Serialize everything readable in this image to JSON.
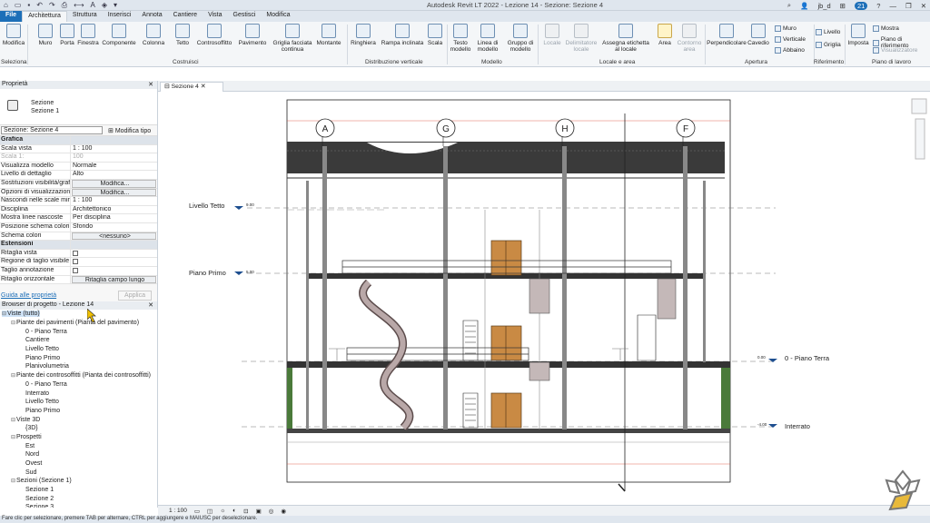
{
  "titlebar": {
    "title": "Autodesk Revit LT 2022 - Lezione 14 - Sezione: Sezione 4",
    "user": "jb_d",
    "badge": "21"
  },
  "tabs": [
    "File",
    "Architettura",
    "Struttura",
    "Inserisci",
    "Annota",
    "Cantiere",
    "Vista",
    "Gestisci",
    "Modifica"
  ],
  "ribbon": {
    "buttons": [
      "Modifica",
      "Muro",
      "Porta",
      "Finestra",
      "Componente",
      "Colonna",
      "Tetto",
      "Controsoffitto",
      "Pavimento",
      "Griglia facciata continua",
      "Montante",
      "Ringhiera",
      "Rampa inclinata",
      "Scala",
      "Testo modello",
      "Linea di modello",
      "Gruppo di modello",
      "Locale",
      "Delimitatore locale",
      "Assegna etichetta al locale",
      "Area",
      "Contorno area",
      "Perpendicolare",
      "Cavedio",
      "Imposta"
    ],
    "small": [
      "Muro",
      "Verticale",
      "Abbaino",
      "Livello",
      "Griglia",
      "Mostra",
      "Piano di riferimento",
      "Visualizzatore"
    ],
    "groups": [
      "Seleziona",
      "Costruisci",
      "Distribuzione verticale",
      "Modello",
      "Locale e area",
      "Apertura",
      "Riferimento",
      "Piano di lavoro"
    ]
  },
  "properties": {
    "header": "Proprietà",
    "type_line1": "Sezione",
    "type_line2": "Sezione 1",
    "instance": "Sezione: Sezione 4",
    "edit_type": "Modifica tipo",
    "rows": [
      {
        "k": "Grafica",
        "v": "",
        "cat": true
      },
      {
        "k": "Scala vista",
        "v": "1 : 100"
      },
      {
        "k": "Scala 1:",
        "v": "100",
        "dim": true
      },
      {
        "k": "Visualizza modello",
        "v": "Normale"
      },
      {
        "k": "Livello di dettaglio",
        "v": "Alto"
      },
      {
        "k": "Sostituzioni visibilità/grafi...",
        "v": "Modifica...",
        "btn": true
      },
      {
        "k": "Opzioni di visualizzazione ...",
        "v": "Modifica...",
        "btn": true
      },
      {
        "k": "Nascondi nelle scale min...",
        "v": "1 : 100"
      },
      {
        "k": "Disciplina",
        "v": "Architettonico"
      },
      {
        "k": "Mostra linee nascoste",
        "v": "Per disciplina"
      },
      {
        "k": "Posizione schema colori",
        "v": "Sfondo"
      },
      {
        "k": "Schema colori",
        "v": "<nessuno>",
        "btn": true
      },
      {
        "k": "Estensioni",
        "v": "",
        "cat": true
      },
      {
        "k": "Ritaglia vista",
        "v": "",
        "check": true
      },
      {
        "k": "Regione di taglio visibile",
        "v": "",
        "check": true
      },
      {
        "k": "Taglio annotazione",
        "v": "",
        "check": true
      },
      {
        "k": "Ritaglio orizzontale",
        "v": "Ritaglia campo lungo",
        "btn": true
      }
    ],
    "help_link": "Guida alle proprietà",
    "apply": "Applica"
  },
  "browser": {
    "header": "Browser di progetto - Lezione 14",
    "nodes": [
      {
        "t": "Viste (tutto)",
        "lvl": 0,
        "sel": true,
        "tg": "⊟"
      },
      {
        "t": "Piante dei pavimenti (Pianta del pavimento)",
        "lvl": 1,
        "tg": "⊟"
      },
      {
        "t": "0 - Piano Terra",
        "lvl": 2
      },
      {
        "t": "Cantiere",
        "lvl": 2
      },
      {
        "t": "Livello Tetto",
        "lvl": 2
      },
      {
        "t": "Piano Primo",
        "lvl": 2
      },
      {
        "t": "Planivolumetria",
        "lvl": 2
      },
      {
        "t": "Piante dei controsoffitti (Pianta dei controsoffitti)",
        "lvl": 1,
        "tg": "⊟"
      },
      {
        "t": "0 - Piano Terra",
        "lvl": 2
      },
      {
        "t": "Interrato",
        "lvl": 2
      },
      {
        "t": "Livello Tetto",
        "lvl": 2
      },
      {
        "t": "Piano Primo",
        "lvl": 2
      },
      {
        "t": "Viste 3D",
        "lvl": 1,
        "tg": "⊟"
      },
      {
        "t": "{3D}",
        "lvl": 2
      },
      {
        "t": "Prospetti",
        "lvl": 1,
        "tg": "⊟"
      },
      {
        "t": "Est",
        "lvl": 2
      },
      {
        "t": "Nord",
        "lvl": 2
      },
      {
        "t": "Ovest",
        "lvl": 2
      },
      {
        "t": "Sud",
        "lvl": 2
      },
      {
        "t": "Sezioni (Sezione 1)",
        "lvl": 1,
        "tg": "⊟"
      },
      {
        "t": "Sezione 1",
        "lvl": 2
      },
      {
        "t": "Sezione 2",
        "lvl": 2
      },
      {
        "t": "Sezione 3",
        "lvl": 2
      }
    ]
  },
  "view": {
    "tab": "Sezione 4",
    "grids": [
      "A",
      "G",
      "H",
      "F"
    ],
    "levels": [
      {
        "name": "Livello Tetto",
        "elev": "9.00"
      },
      {
        "name": "Piano Primo",
        "elev": "5.00"
      },
      {
        "name": "0 - Piano Terra",
        "elev": "0.00"
      },
      {
        "name": "Interrato",
        "elev": "-4.00"
      }
    ]
  },
  "status": {
    "scale": "1 : 100",
    "hint": "Fare clic per selezionare, premere TAB per alternare, CTRL per aggiungere e MAIUSC per deselezionare."
  }
}
